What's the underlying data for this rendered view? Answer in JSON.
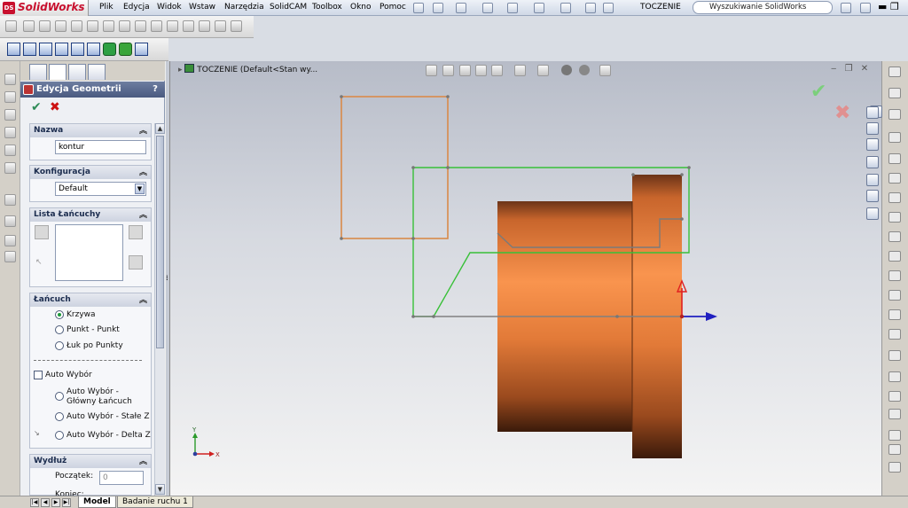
{
  "app": {
    "name": "SolidWorks",
    "logo_letters": "DS"
  },
  "menu": {
    "items": [
      "Plik",
      "Edycja",
      "Widok",
      "Wstaw",
      "Narzędzia",
      "SolidCAM",
      "Toolbox",
      "Okno",
      "Pomoc"
    ]
  },
  "document": {
    "title": "TOCZENIE"
  },
  "search": {
    "placeholder": "Wyszukiwanie SolidWorks"
  },
  "panel": {
    "title": "Edycja Geometrii",
    "help": "?",
    "nazwa": {
      "header": "Nazwa",
      "value": "kontur"
    },
    "konfiguracja": {
      "header": "Konfiguracja",
      "value": "Default"
    },
    "lista": {
      "header": "Lista Łańcuchy"
    },
    "lancuch": {
      "header": "Łańcuch",
      "options": [
        "Krzywa",
        "Punkt - Punkt",
        "Łuk po Punkty"
      ],
      "selected": "Krzywa",
      "auto_label": "Auto Wybór",
      "auto_options": [
        "Auto Wybór - Główny Łańcuch",
        "Auto Wybór - Stałe Z",
        "Auto Wybór - Delta Z"
      ]
    },
    "wydluz": {
      "header": "Wydłuż",
      "start_label": "Początek:",
      "start_value": "0",
      "end_label": "Koniec:"
    }
  },
  "viewport": {
    "tree_label": "TOCZENIE  (Default<Stan wy..."
  },
  "triad": {
    "x": "X",
    "y": "Y"
  },
  "tabs": [
    "Model",
    "Badanie ruchu 1"
  ],
  "colors": {
    "part_orange": "#f0883a",
    "profile_green": "#38c038",
    "stock_orange": "#d98a4a"
  }
}
